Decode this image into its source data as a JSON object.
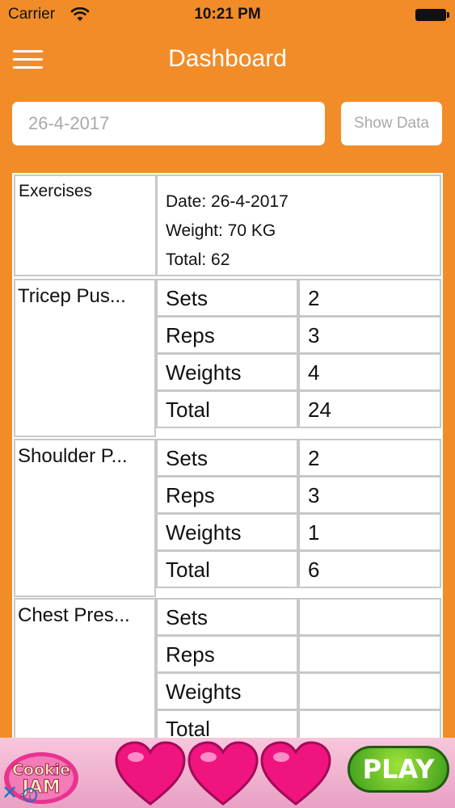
{
  "status_bar": {
    "carrier": "Carrier",
    "time": "10:21 PM"
  },
  "nav": {
    "title": "Dashboard"
  },
  "search": {
    "date_placeholder": "26-4-2017",
    "show_label": "Show Data"
  },
  "summary": {
    "exercises_label": "Exercises",
    "date": "Date: 26-4-2017",
    "weight": "Weight: 70 KG",
    "total": "Total: 62"
  },
  "exercises": [
    {
      "name": "Tricep Pus...",
      "rows": [
        {
          "label": "Sets",
          "value": "2"
        },
        {
          "label": "Reps",
          "value": "3"
        },
        {
          "label": "Weights",
          "value": "4"
        },
        {
          "label": "Total",
          "value": "24"
        }
      ]
    },
    {
      "name": "Shoulder P...",
      "rows": [
        {
          "label": "Sets",
          "value": "2"
        },
        {
          "label": "Reps",
          "value": "3"
        },
        {
          "label": "Weights",
          "value": "1"
        },
        {
          "label": "Total",
          "value": "6"
        }
      ]
    },
    {
      "name": "Chest Pres...",
      "rows": [
        {
          "label": "Sets",
          "value": ""
        },
        {
          "label": "Reps",
          "value": ""
        },
        {
          "label": "Weights",
          "value": ""
        },
        {
          "label": "Total",
          "value": ""
        }
      ]
    }
  ],
  "ad": {
    "brand_line1": "Cookie",
    "brand_line2": "JAM",
    "cta": "PLAY",
    "close": "✕",
    "info": "i"
  },
  "colors": {
    "background": "#f28c28",
    "cell_border": "#c8c8c8"
  }
}
